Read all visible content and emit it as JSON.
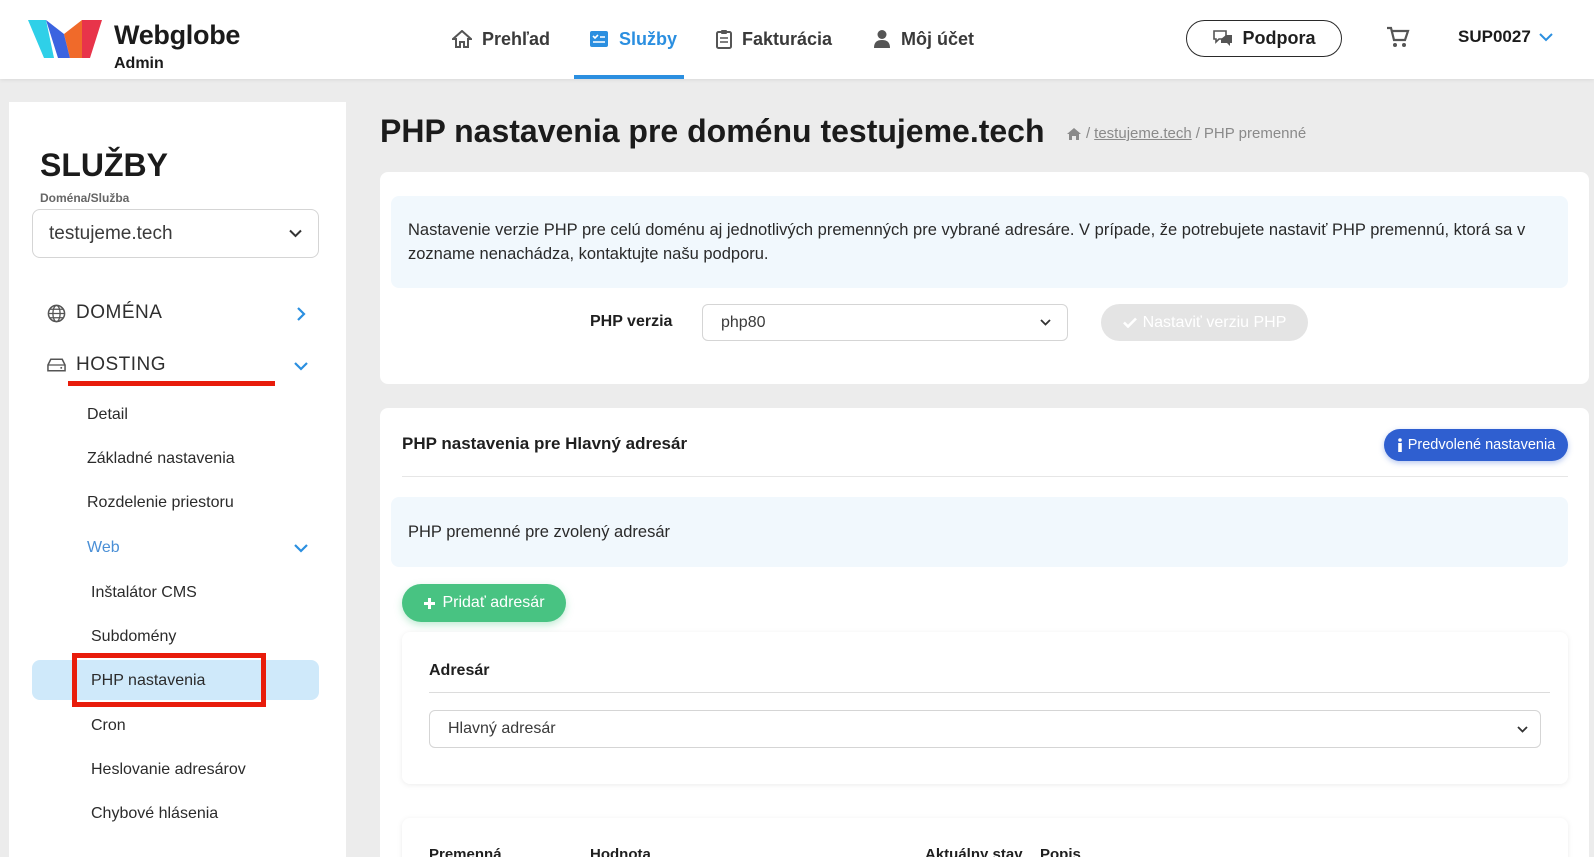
{
  "brand": {
    "name": "Webglobe",
    "sub": "Admin"
  },
  "nav": {
    "items": [
      {
        "label": "Prehľad",
        "icon": "home-icon"
      },
      {
        "label": "Služby",
        "icon": "services-icon"
      },
      {
        "label": "Fakturácia",
        "icon": "clipboard-icon"
      },
      {
        "label": "Môj účet",
        "icon": "user-icon"
      }
    ],
    "support": "Podpora",
    "account": "SUP0027"
  },
  "colors": {
    "accent": "#2b8fe0",
    "primary_button": "#2f5fd0",
    "success_button": "#48c382",
    "highlight": "#e81c0b",
    "active_bg": "#cfe9fa"
  },
  "sidebar": {
    "title": "SLUŽBY",
    "select_label": "Doména/Služba",
    "select_value": "testujeme.tech",
    "sections": [
      {
        "label": "DOMÉNA",
        "icon": "globe-icon"
      },
      {
        "label": "HOSTING",
        "icon": "server-icon"
      }
    ],
    "links": [
      "Detail",
      "Základné nastavenia",
      "Rozdelenie priestoru",
      "Web"
    ],
    "web_links": [
      "Inštalátor CMS",
      "Subdomény",
      "PHP nastavenia",
      "Cron",
      "Heslovanie adresárov",
      "Chybové hlásenia"
    ]
  },
  "main": {
    "title": "PHP nastavenia pre doménu testujeme.tech",
    "breadcrumb": {
      "link": "testujeme.tech",
      "current": "PHP premenné",
      "separator": "/"
    },
    "info": "Nastavenie verzie PHP pre celú doménu aj jednotlivých premenných pre vybrané adresáre. V prípade, že potrebujete nastaviť PHP premennú, ktorá sa v zozname nenachádza, kontaktujte našu podporu.",
    "php_version_label": "PHP verzia",
    "php_version_value": "php80",
    "set_version_button": "Nastaviť verziu PHP",
    "section_title": "PHP nastavenia pre Hlavný adresár",
    "default_button": "Predvolené nastavenia",
    "vars_info": "PHP premenné pre zvolený adresár",
    "add_dir_button": "Pridať adresár",
    "dir_label": "Adresár",
    "dir_value": "Hlavný adresár",
    "table_headers": [
      "Premenná",
      "Hodnota",
      "Aktuálny stav",
      "Popis"
    ]
  }
}
